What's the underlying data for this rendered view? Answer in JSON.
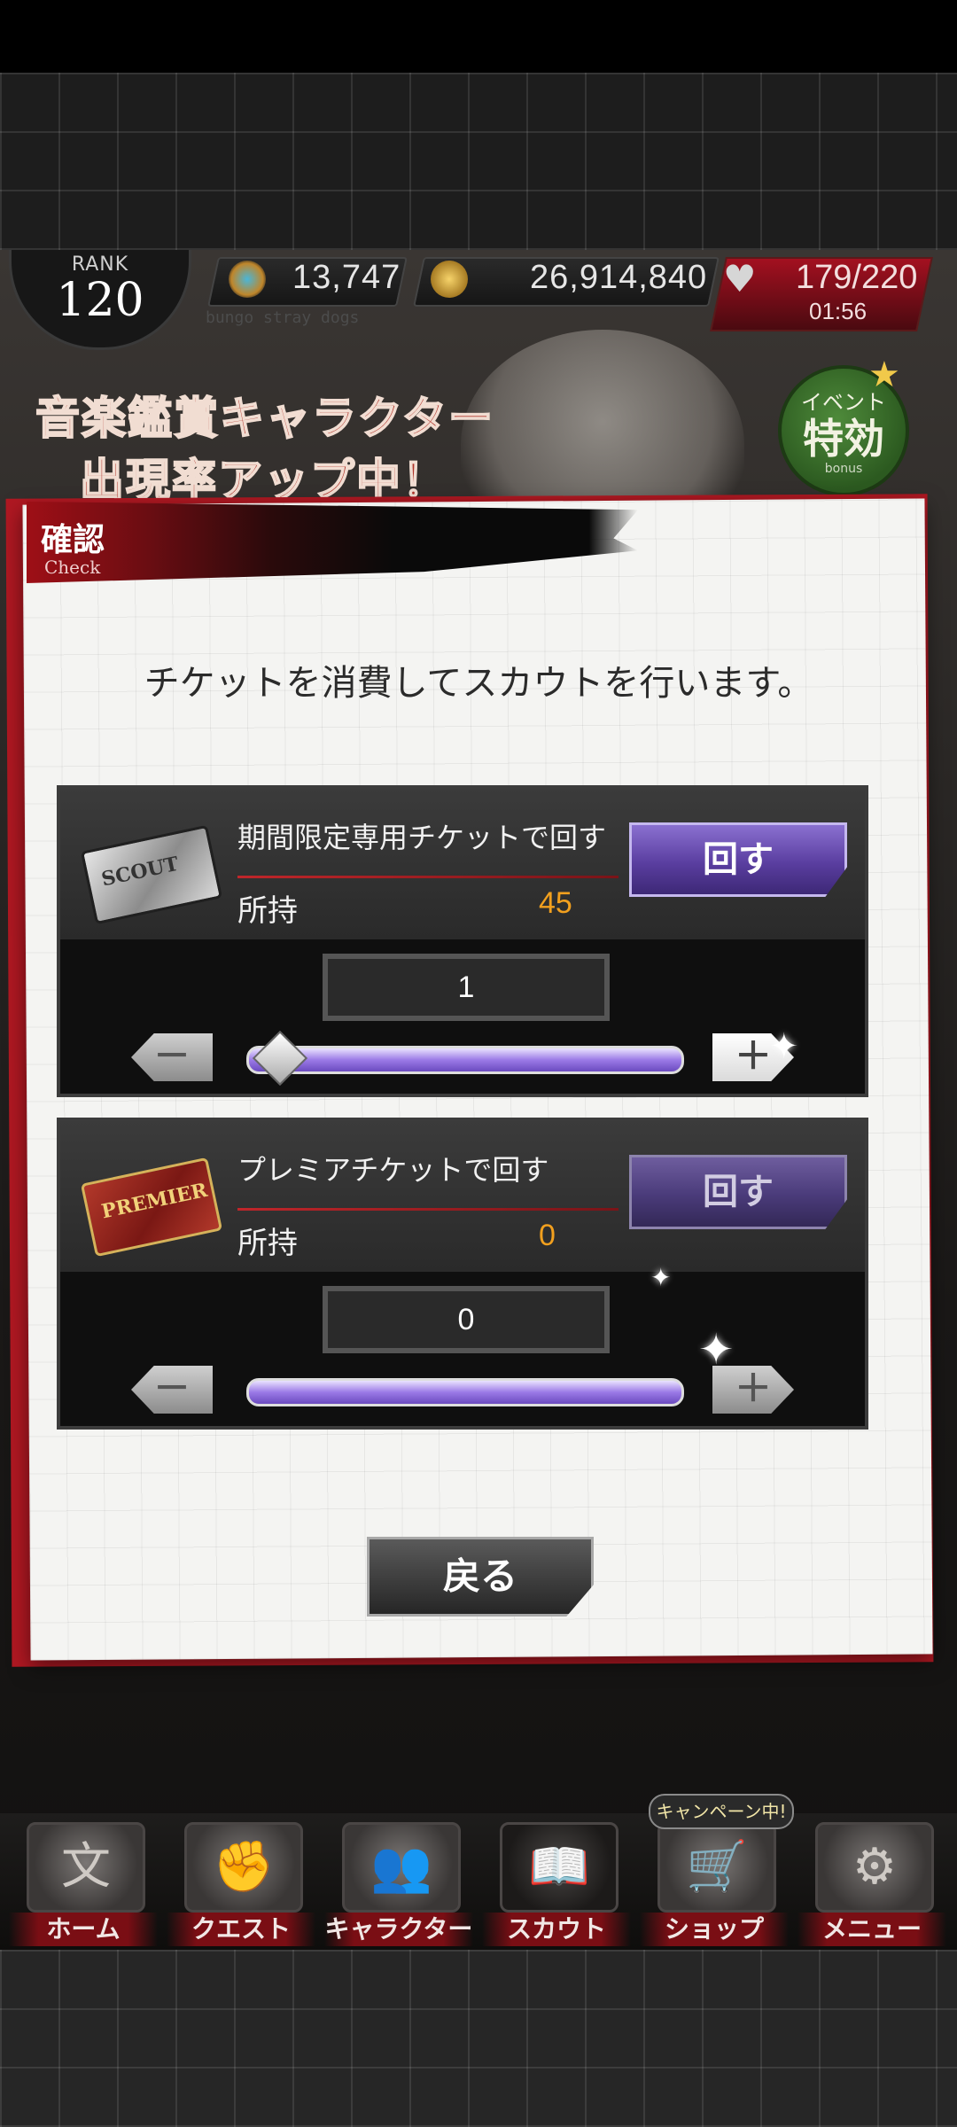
{
  "header": {
    "rank_label": "RANK",
    "rank_value": "120",
    "gems": "13,747",
    "coins": "26,914,840",
    "stamina": "179/220",
    "stamina_timer": "01:56",
    "subtitle": "bungo stray dogs"
  },
  "banner": {
    "title_line1": "音楽鑑賞キャラクター",
    "title_line2": "出現率アップ中！",
    "event_badge_top": "イベント",
    "event_badge_main": "特効",
    "event_badge_sub": "bonus"
  },
  "modal": {
    "title": "確認",
    "title_sub": "Check",
    "message": "チケットを消費してスカウトを行います。",
    "back_label": "戻る",
    "tickets": [
      {
        "icon": "scout-ticket-icon",
        "icon_text": "SCOUT",
        "label": "期間限定専用チケットで回す",
        "owned_label": "所持",
        "owned_value": "45",
        "spin_label": "回す",
        "count": "1",
        "minus": "－",
        "plus": "＋"
      },
      {
        "icon": "premier-ticket-icon",
        "icon_text": "PREMIER",
        "label": "プレミアチケットで回す",
        "owned_label": "所持",
        "owned_value": "0",
        "spin_label": "回す",
        "count": "0",
        "minus": "－",
        "plus": "＋"
      }
    ]
  },
  "nav": {
    "campaign_badge": "キャンペーン中!",
    "items": [
      {
        "label": "ホーム",
        "icon": "文"
      },
      {
        "label": "クエスト",
        "icon": "✊"
      },
      {
        "label": "キャラクター",
        "icon": "👥"
      },
      {
        "label": "スカウト",
        "icon": "📖"
      },
      {
        "label": "ショップ",
        "icon": "🛒"
      },
      {
        "label": "メニュー",
        "icon": "⚙"
      }
    ]
  },
  "colors": {
    "accent_red": "#b01822",
    "spin_purple": "#5a3ea0",
    "owned_orange": "#f2a01e"
  }
}
